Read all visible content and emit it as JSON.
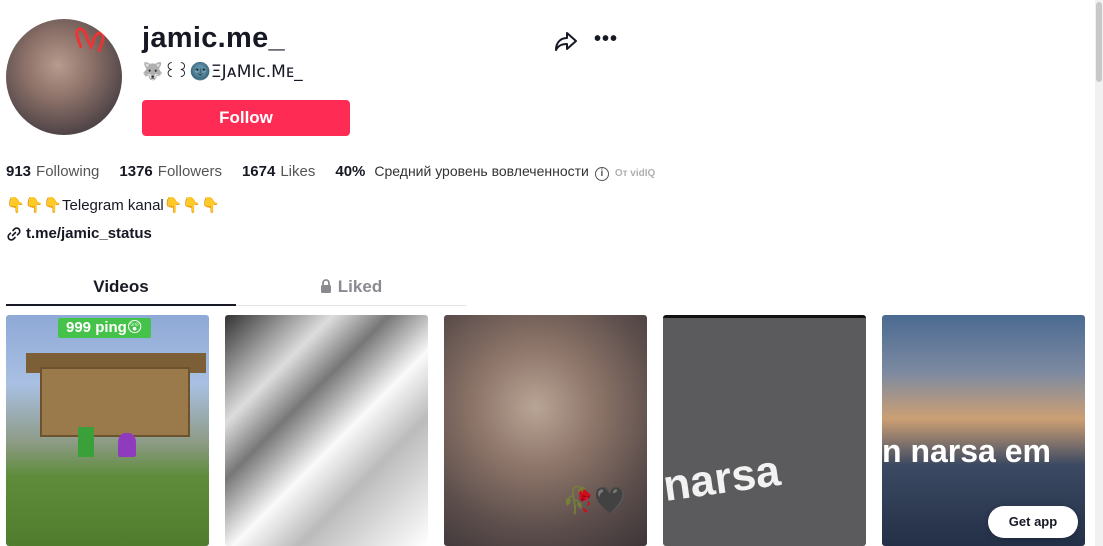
{
  "profile": {
    "username": "jamic.me_",
    "nickname": "🐺꒰꒱🌚ΞJᴀMIc.Mᴇ_",
    "follow_label": "Follow"
  },
  "stats": {
    "following_count": "913",
    "following_label": "Following",
    "followers_count": "1376",
    "followers_label": "Followers",
    "likes_count": "1674",
    "likes_label": "Likes",
    "engagement_value": "40%",
    "engagement_label": "Средний уровень вовлеченности",
    "vidiq_label": "От vidIQ"
  },
  "bio": {
    "text": "👇👇👇Telegram kanal👇👇👇",
    "link": "t.me/jamic_status"
  },
  "tabs": {
    "videos_label": "Videos",
    "liked_label": "Liked"
  },
  "videos": [
    {
      "overlay": "999 ping😲"
    },
    {
      "overlay": ""
    },
    {
      "overlay": "🥀🖤"
    },
    {
      "overlay": "narsa"
    },
    {
      "overlay": "n narsa em"
    }
  ],
  "get_app_label": "Get app",
  "colors": {
    "follow_button": "#fe2c55",
    "text_primary": "#161823",
    "text_secondary": "#8a8b91"
  }
}
